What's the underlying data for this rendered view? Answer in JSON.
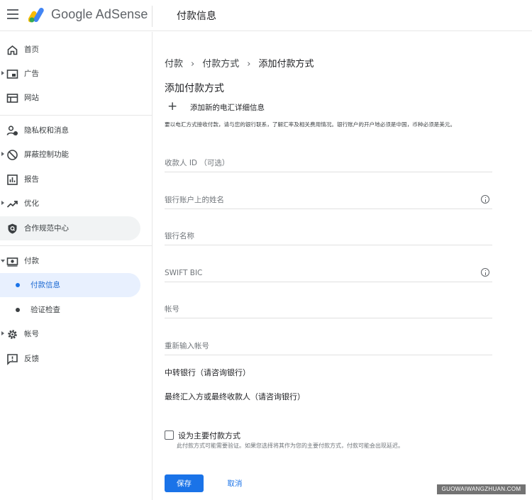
{
  "header": {
    "brand": "Google AdSense",
    "title": "付款信息"
  },
  "sidebar": {
    "items": [
      {
        "label": "首页",
        "icon": "home-icon"
      },
      {
        "label": "广告",
        "icon": "ads-icon"
      },
      {
        "label": "网站",
        "icon": "sites-icon"
      },
      {
        "label": "隐私权和消息",
        "icon": "privacy-icon"
      },
      {
        "label": "屏蔽控制功能",
        "icon": "block-icon"
      },
      {
        "label": "报告",
        "icon": "report-icon"
      },
      {
        "label": "优化",
        "icon": "optimize-icon"
      },
      {
        "label": "合作规范中心",
        "icon": "policy-center-icon"
      },
      {
        "label": "付款",
        "icon": "payments-icon"
      },
      {
        "label": "付款信息"
      },
      {
        "label": "验证检查"
      },
      {
        "label": "帐号",
        "icon": "gear-icon"
      },
      {
        "label": "反馈",
        "icon": "feedback-icon"
      }
    ]
  },
  "breadcrumb": {
    "items": [
      "付款",
      "付款方式",
      "添加付款方式"
    ]
  },
  "page_title": "添加付款方式",
  "add_wire_label": "添加新的电汇详细信息",
  "description": "要以电汇方式接收付款，请与您的银行联系，了解汇率及相关费用情况。银行账户的开户地必须是中国，币种必须是美元。",
  "form": {
    "payee_id_placeholder": "收款人 ID （可选）",
    "account_name_placeholder": "银行账户上的姓名",
    "bank_name_placeholder": "银行名称",
    "swift_placeholder": "SWIFT BIC",
    "account_number_placeholder": "帐号",
    "account_number_confirm_placeholder": "重新输入帐号",
    "intermediary_bank_label": "中转银行（请咨询银行）",
    "final_recipient_label": "最终汇入方或最终收款人（请咨询银行）"
  },
  "primary": {
    "label": "设为主要付款方式",
    "hint": "此付款方式可能需要验证。如果您选择将其作为您的主要付款方式，付款可能会出现延迟。",
    "checked": false
  },
  "buttons": {
    "save": "保存",
    "cancel": "取消"
  },
  "watermark": "GUOWAIWANGZHUAN.COM",
  "colors": {
    "accent": "#1a73e8",
    "active_bg": "#e8f0fe"
  }
}
